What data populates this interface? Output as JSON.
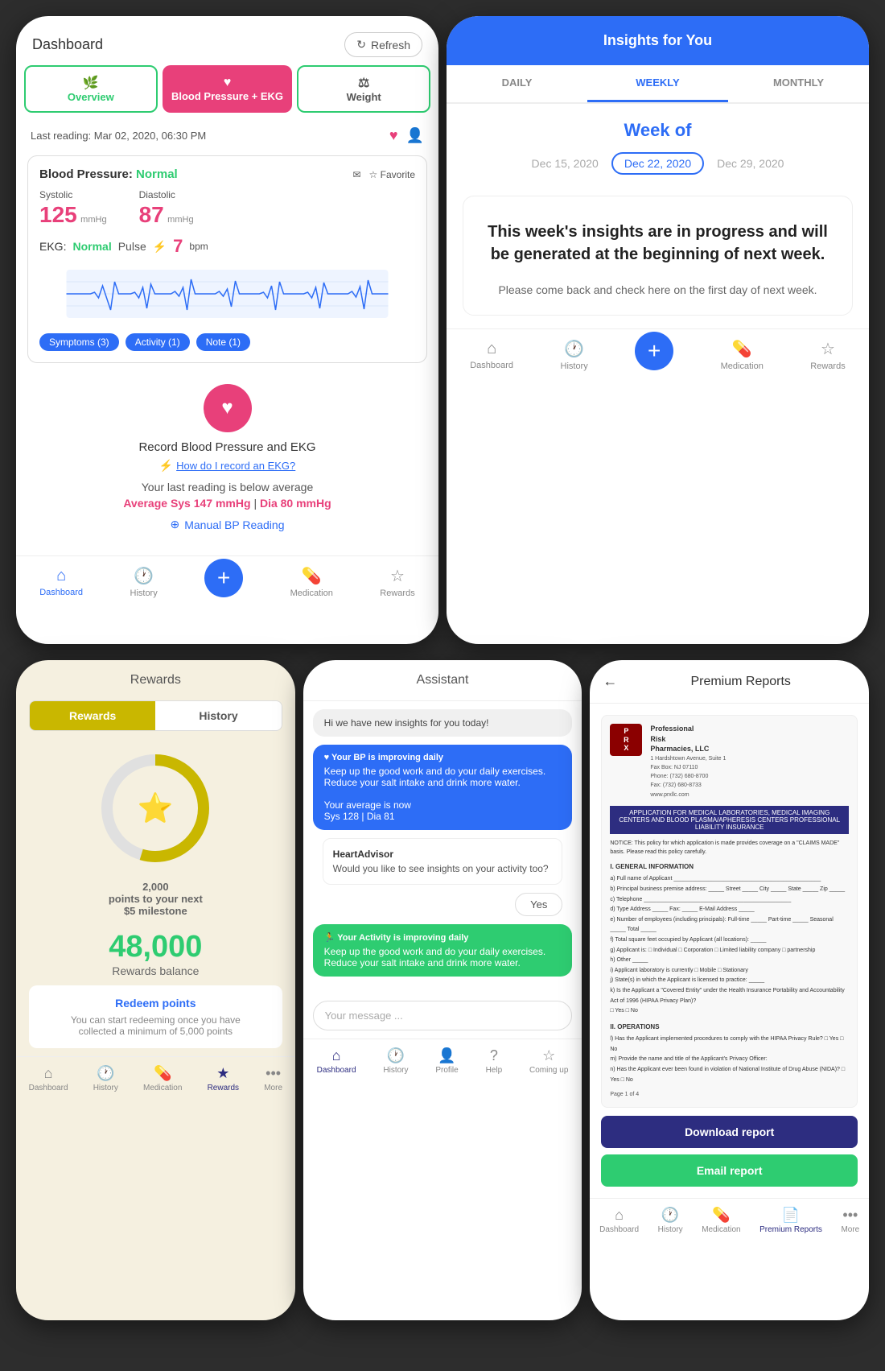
{
  "dashboard": {
    "title": "Dashboard",
    "refresh_label": "Refresh",
    "tabs": [
      {
        "label": "Overview",
        "style": "overview"
      },
      {
        "label": "Blood Pressure + EKG",
        "style": "bp"
      },
      {
        "label": "Weight",
        "style": "weight"
      }
    ],
    "last_reading": "Last reading: Mar 02, 2020, 06:30 PM",
    "bp_card": {
      "label": "Blood Pressure:",
      "status": "Normal",
      "systolic_label": "Systolic",
      "systolic_value": "125",
      "systolic_unit": "mmHg",
      "diastolic_label": "Diastolic",
      "diastolic_value": "87",
      "diastolic_unit": "mmHg",
      "ekg_label": "EKG:",
      "ekg_status": "Normal",
      "pulse_label": "Pulse",
      "pulse_value": "7",
      "pulse_unit": "bpm",
      "tags": [
        "Symptoms (3)",
        "Activity (1)",
        "Note (1)"
      ]
    },
    "record_section": {
      "title": "Record Blood Pressure and EKG",
      "link": "How do I record an EKG?",
      "avg_text": "Your last reading is below average",
      "avg_sys": "Average Sys 147 mmHg",
      "avg_dia": "Dia 80 mmHg",
      "manual_bp": "Manual BP Reading"
    },
    "nav": [
      "Dashboard",
      "History",
      "",
      "Medication",
      "Rewards"
    ]
  },
  "insights": {
    "header": "Insights for You",
    "tabs": [
      "DAILY",
      "WEEKLY",
      "MONTHLY"
    ],
    "active_tab": "WEEKLY",
    "week_of": "Week of",
    "dates": [
      "Dec 15, 2020",
      "Dec 22, 2020",
      "Dec 29, 2020"
    ],
    "active_date": "Dec 22, 2020",
    "card": {
      "main_text": "This week's insights are in progress and will be generated at the beginning of next week.",
      "sub_text": "Please come back and check here on the first day of next week."
    },
    "nav": [
      "Dashboard",
      "History",
      "",
      "Medication",
      "Rewards"
    ]
  },
  "rewards": {
    "header": "Rewards",
    "tabs": [
      "Rewards",
      "History"
    ],
    "active_tab": "Rewards",
    "points_next": "2,000\npoints to your next\n$5 milestone",
    "balance": "48,000",
    "balance_label": "Rewards balance",
    "redeem_title": "Redeem points",
    "redeem_sub": "You can start redeeming once you have\ncollected a minimum of 5,000 points",
    "nav": [
      "Dashboard",
      "History",
      "Medication",
      "Rewards",
      "More"
    ]
  },
  "assistant": {
    "header": "Assistant",
    "messages": [
      {
        "type": "gray",
        "text": "Hi we have new insights for you today!"
      },
      {
        "type": "blue",
        "tag": "♥ Your BP is improving daily",
        "text": "Keep up the good work and do your daily exercises. Reduce your salt intake and drink more water.\n\nYour average is now\nSys 128 | Dia 81"
      },
      {
        "type": "ha",
        "name": "HeartAdvisor",
        "text": "Would you like to see insights on your activity too?"
      },
      {
        "type": "yes"
      },
      {
        "type": "green",
        "tag": "🏃 Your Activity is improving daily",
        "text": "Keep up the good work and do your daily exercises. Reduce your salt intake and drink more water."
      }
    ],
    "input_placeholder": "Your message ...",
    "nav": [
      "Dashboard",
      "History",
      "Profile",
      "Help",
      "Coming up"
    ]
  },
  "premium_reports": {
    "header": "Premium Reports",
    "back": "←",
    "doc": {
      "org_name": "Professional\nRisk\nPharmacies, LLC",
      "address": "1 Hardshtown Avenue, Suite 1\nFax Box: NJ 07110\nPhone: (732) 680-8700\nFax: (732) 680-8733\nwww.prxllc.com",
      "title": "APPLICATION FOR MEDICAL LABORATORIES, MEDICAL IMAGING CENTERS AND BLOOD PLASMA/APHERESIS CENTERS PROFESSIONAL LIABILITY INSURANCE",
      "notice": "NOTICE: This policy for which application is made provides coverage on a \"CLAIMS MADE\" basis. Please read this policy carefully.",
      "sections": [
        {
          "title": "GENERAL INFORMATION",
          "lines": 12
        },
        {
          "title": "OPERATIONS",
          "lines": 8
        }
      ],
      "page": "Page 1 of 4"
    },
    "download_label": "Download report",
    "email_label": "Email report",
    "nav": [
      "Dashboard",
      "History",
      "Medication",
      "Premium Reports",
      "More"
    ]
  }
}
